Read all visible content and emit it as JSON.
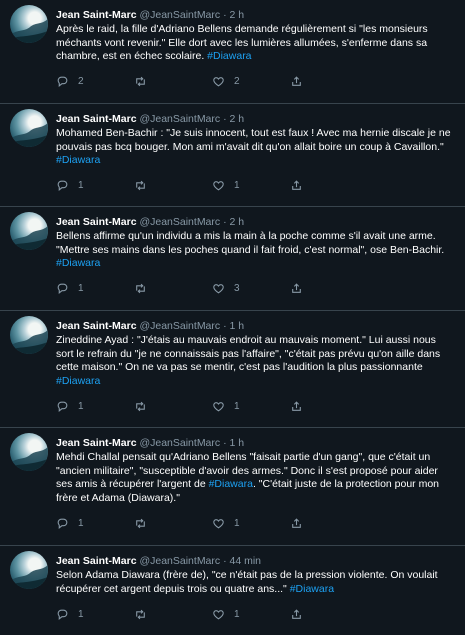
{
  "tweets": [
    {
      "name": "Jean Saint-Marc",
      "handle": "@JeanSaintMarc",
      "separator": "·",
      "time": "2 h",
      "text": "Après le raid, la fille d'Adriano Bellens demande régulièrement si \"les monsieurs méchants vont revenir.\" Elle dort avec les lumières allumées, s'enferme dans sa chambre, est en échec scolaire. ",
      "hashtag": "#Diawara",
      "replies": "2",
      "retweets": "",
      "likes": "2"
    },
    {
      "name": "Jean Saint-Marc",
      "handle": "@JeanSaintMarc",
      "separator": "·",
      "time": "2 h",
      "text": "Mohamed Ben-Bachir : \"Je suis innocent, tout est faux ! Avec ma hernie discale je ne pouvais pas bcq bouger. Mon ami m'avait dit qu'on allait boire un coup à Cavaillon.\" ",
      "hashtag": "#Diawara",
      "replies": "1",
      "retweets": "",
      "likes": "1"
    },
    {
      "name": "Jean Saint-Marc",
      "handle": "@JeanSaintMarc",
      "separator": "·",
      "time": "2 h",
      "text": "Bellens affirme qu'un individu a mis la main à la poche comme s'il avait une arme. \"Mettre ses mains dans les poches quand il fait froid, c'est normal\", ose Ben-Bachir. ",
      "hashtag": "#Diawara",
      "replies": "1",
      "retweets": "",
      "likes": "3"
    },
    {
      "name": "Jean Saint-Marc",
      "handle": "@JeanSaintMarc",
      "separator": "·",
      "time": "1 h",
      "text": "Zineddine Ayad : \"J'étais au mauvais endroit au mauvais moment.\" Lui aussi nous sort le refrain du \"je ne connaissais pas l'affaire\", \"c'était pas prévu qu'on aille dans cette maison.\" On ne va pas se mentir, c'est pas l'audition la plus passionnante ",
      "hashtag": "#Diawara",
      "replies": "1",
      "retweets": "",
      "likes": "1"
    },
    {
      "name": "Jean Saint-Marc",
      "handle": "@JeanSaintMarc",
      "separator": "·",
      "time": "1 h",
      "text": "Mehdi Challal pensait qu'Adriano Bellens \"faisait partie d'un gang\", que c'était un \"ancien militaire\", \"susceptible d'avoir des armes.\" Donc il s'est proposé pour aider ses amis à récupérer l'argent de ",
      "hashtag": "#Diawara",
      "text_after": ". \"C'était juste de la protection pour mon frère et Adama (Diawara).\"",
      "replies": "1",
      "retweets": "",
      "likes": "1"
    },
    {
      "name": "Jean Saint-Marc",
      "handle": "@JeanSaintMarc",
      "separator": "·",
      "time": "44 min",
      "text": "Selon Adama Diawara (frère de), \"ce n'était pas de la pression violente. On voulait récupérer cet argent depuis trois ou quatre ans...\" ",
      "hashtag": "#Diawara",
      "replies": "1",
      "retweets": "",
      "likes": "1"
    }
  ]
}
